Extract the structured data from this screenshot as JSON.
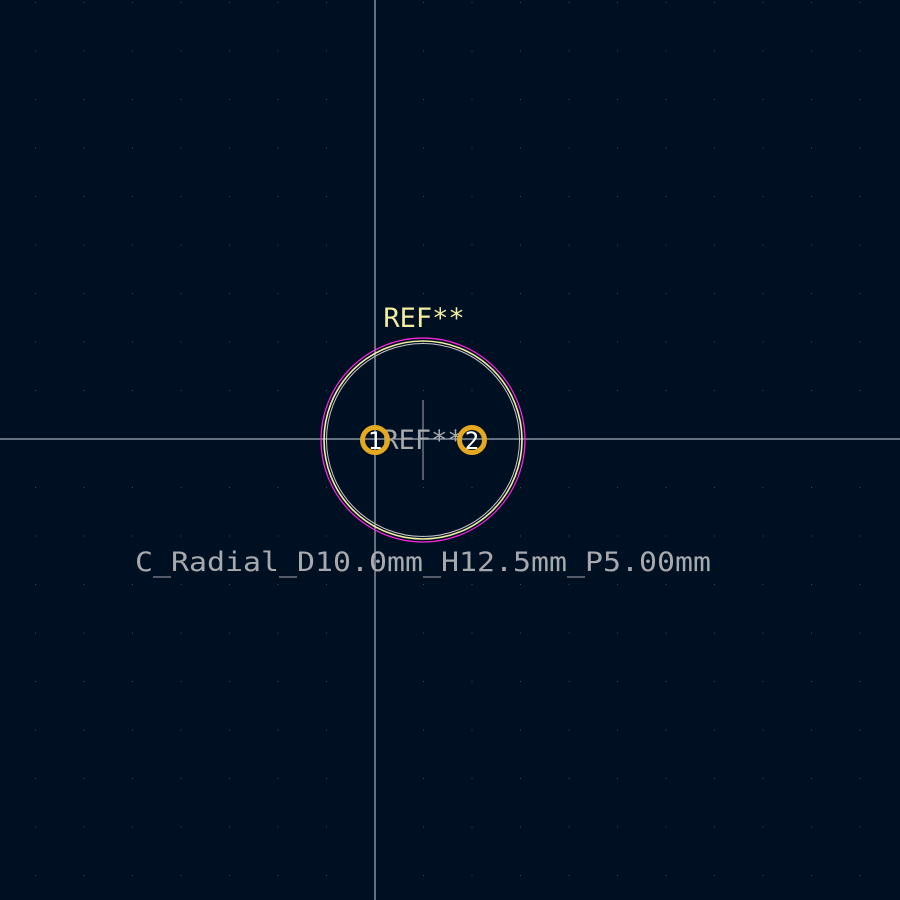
{
  "colors": {
    "background": "#001023",
    "grid_dot": "#3c4a5c",
    "crosshair": "#c8d2dc",
    "courtyard": "#ff26e2",
    "fab_outline": "#c8c8c8",
    "silkscreen": "#f2eda1",
    "pad": "#e5a91f",
    "fab_text": "#a6a9ad",
    "value_text": "#a6a9ad",
    "pad_number": "#ffffff"
  },
  "footprint": {
    "reference_silk": "REF**",
    "reference_fab": "REF**",
    "value": "C_Radial_D10.0mm_H12.5mm_P5.00mm",
    "pads": [
      {
        "number": "1"
      },
      {
        "number": "2"
      }
    ]
  }
}
